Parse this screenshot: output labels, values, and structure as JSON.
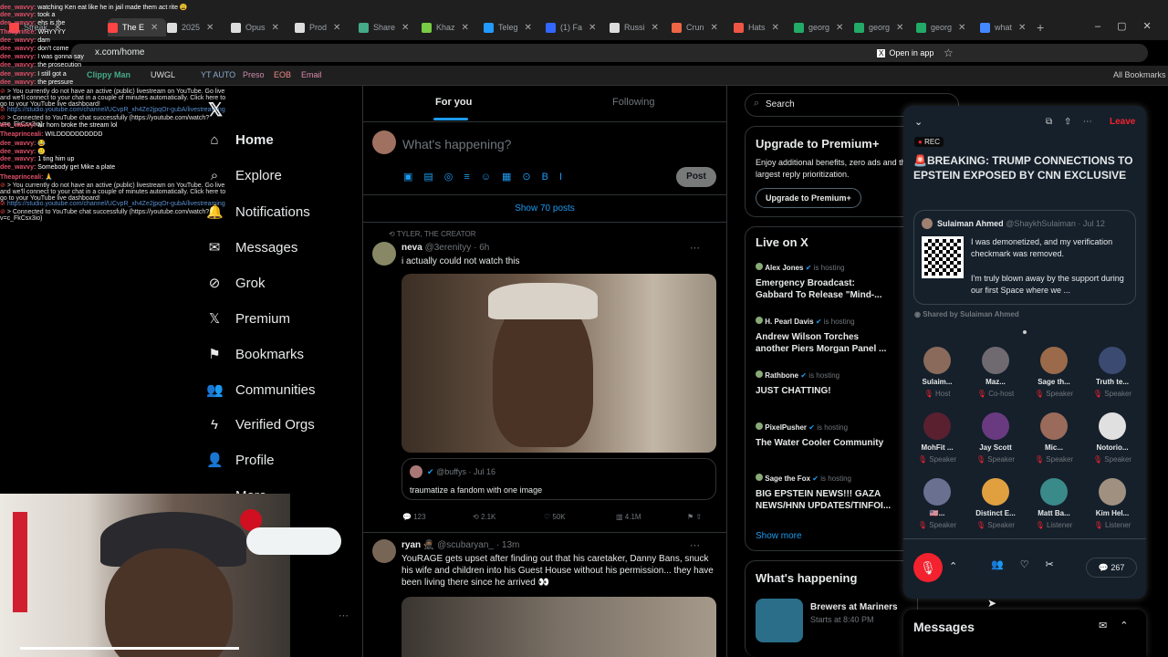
{
  "browser": {
    "tabs": [
      "Streak",
      "The E",
      "2025",
      "Opus",
      "Prod",
      "Share",
      "Khaz",
      "Teleg",
      "(1) Fa",
      "Russi",
      "Crun",
      "Hats",
      "georg",
      "georg",
      "georg",
      "what"
    ],
    "url": "x.com/home",
    "open_in_app": "Open in app"
  },
  "bookmarks": {
    "items": [
      "Clippy Man",
      "UWGL",
      "YT AUTO",
      "Preso",
      "EOB",
      "Email"
    ],
    "all": "All Bookmarks"
  },
  "chat": {
    "lines": [
      {
        "user": "dee_wavvy:",
        "text": "watching Ken eat like he in jail made them act rite 😩"
      },
      {
        "user": "dee_wavvy:",
        "text": "took a "
      },
      {
        "user": "dee_wavvy:",
        "text": "ehs is the"
      },
      {
        "user": "Theaprince:",
        "text": "WHYYYY"
      },
      {
        "user": "dee_wavvy:",
        "text": "dam"
      },
      {
        "user": "dee_wavvy:",
        "text": "don't come"
      },
      {
        "user": "dee_wavvy:",
        "text": "I was gonna say"
      },
      {
        "user": "dee_wavvy:",
        "text": "the prosecution"
      },
      {
        "user": "dee_wavvy:",
        "text": "I still got a"
      },
      {
        "user": "dee_wavvy:",
        "text": "the pressure"
      },
      {
        "user": "",
        "text": "> You currently do not have an active (public) livestream on YouTube. Go live and we'll connect to your chat in a couple of minutes automatically. Click here to go to your YouTube live dashboard!"
      },
      {
        "user": "",
        "text": "https://studio.youtube.com/channel/UCvpR_xh4Ze2jpqOr-gubA/livestreaming"
      },
      {
        "user": "",
        "text": "> Connected to YouTube chat successfully (https://youtube.com/watch?v=c_FkCsx3io)"
      },
      {
        "user": "dee_wavvy:",
        "text": "air horn broke the stream lol"
      },
      {
        "user": "Theaprinceali:",
        "text": "WILDDDDDDDDDD"
      },
      {
        "user": "dee_wavvy:",
        "text": "😂"
      },
      {
        "user": "dee_wavvy:",
        "text": "🥲"
      },
      {
        "user": "dee_wavvy:",
        "text": "1 ting him up"
      },
      {
        "user": "dee_wavvy:",
        "text": "Somebody get Mike a plate"
      },
      {
        "user": "Theaprinceali:",
        "text": "🙏"
      },
      {
        "user": "",
        "text": "> You currently do not have an active (public) livestream on YouTube. Go live and we'll connect to your chat in a couple of minutes automatically. Click here to go to your YouTube live dashboard!"
      },
      {
        "user": "",
        "text": "https://studio.youtube.com/channel/UCvpR_xh4Ze2jpqOr-gubA/livestreaming"
      },
      {
        "user": "",
        "text": "> Connected to YouTube chat successfully (https://youtube.com/watch?v=c_FkCsx3io)"
      }
    ]
  },
  "nav": {
    "items": [
      "Home",
      "Explore",
      "Notifications",
      "Messages",
      "Grok",
      "Premium",
      "Bookmarks",
      "Communities",
      "Verified Orgs",
      "Profile",
      "More"
    ]
  },
  "feed": {
    "tab_for_you": "For you",
    "tab_following": "Following",
    "compose_placeholder": "What's happening?",
    "post_button": "Post",
    "show_posts": "Show 70 posts"
  },
  "post1": {
    "context": "TYLER, THE CREATOR",
    "name": "neva",
    "handle": "@3erenityy · 6h",
    "text": "i actually could not watch this",
    "quote_handle": "@buffys · Jul 16",
    "quote_text": "traumatize a fandom with one image",
    "replies": "123",
    "reposts": "2.1K",
    "likes": "50K",
    "views": "4.1M"
  },
  "post2": {
    "name": "ryan 🥷🏾",
    "handle": "@scubaryan_ · 13m",
    "text": "YouRAGE gets upset after finding out that his caretaker, Danny Bans, snuck his wife and children into his Guest House without his permission... they have been living there since he arrived 👀"
  },
  "right": {
    "search": "Search",
    "premium_title": "Upgrade to Premium+",
    "premium_desc": "Enjoy additional benefits, zero ads and the largest reply prioritization.",
    "premium_button": "Upgrade to Premium+",
    "live_title": "Live on X",
    "live": [
      {
        "host": "Alex Jones",
        "hosting": "is hosting",
        "title": "Emergency Broadcast: Gabbard To Release \"Mind-..."
      },
      {
        "host": "H. Pearl Davis",
        "hosting": "is hosting",
        "title": "Andrew Wilson Torches another Piers Morgan Panel ..."
      },
      {
        "host": "Rathbone",
        "hosting": "is hosting",
        "title": "JUST CHATTING!"
      },
      {
        "host": "PixelPusher",
        "hosting": "is hosting",
        "title": "The Water Cooler Community"
      },
      {
        "host": "Sage the Fox",
        "hosting": "is hosting",
        "title": "BIG EPSTEIN NEWS!!! GAZA NEWS/HNN UPDATES/TINFOI..."
      }
    ],
    "show_more": "Show more",
    "happening": "What's happening",
    "event": "Brewers at Mariners",
    "event_time": "Starts at 8:40 PM",
    "messages": "Messages"
  },
  "space": {
    "leave": "Leave",
    "rec": "REC",
    "title": "🚨BREAKING: TRUMP CONNECTIONS TO EPSTEIN EXPOSED BY CNN EXCLUSIVE",
    "pinned_name": "Sulaiman Ahmed",
    "pinned_handle": "@ShaykhSulaiman · Jul 12",
    "pinned_text1": "I was demonetized, and my verification checkmark was removed.",
    "pinned_text2": "I'm truly blown away by the support during our first Space where we ...",
    "shared_by": "Shared by Sulaiman Ahmed",
    "count": "267",
    "speakers": [
      {
        "name": "Sulaim...",
        "role": "Host",
        "color": "#8a6a5a"
      },
      {
        "name": "Maz...",
        "role": "Co-host",
        "color": "#6e6a70"
      },
      {
        "name": "Sage th...",
        "role": "Speaker",
        "color": "#9a6a4a"
      },
      {
        "name": "Truth te...",
        "role": "Speaker",
        "color": "#3a4a70"
      },
      {
        "name": "MohFit ...",
        "role": "Speaker",
        "color": "#5a2030"
      },
      {
        "name": "Jay Scott",
        "role": "Speaker",
        "color": "#6a3a80"
      },
      {
        "name": "Mic...",
        "role": "Speaker",
        "color": "#9a6a5a"
      },
      {
        "name": "Notorio...",
        "role": "Speaker",
        "color": "#e0e0e0"
      },
      {
        "name": "🇺🇸...",
        "role": "Speaker",
        "color": "#6a7090"
      },
      {
        "name": "Distinct E...",
        "role": "Speaker",
        "color": "#e0a040"
      },
      {
        "name": "Matt Ba...",
        "role": "Listener",
        "color": "#3a8a8a"
      },
      {
        "name": "Kim Hel...",
        "role": "Listener",
        "color": "#a09080"
      }
    ]
  }
}
